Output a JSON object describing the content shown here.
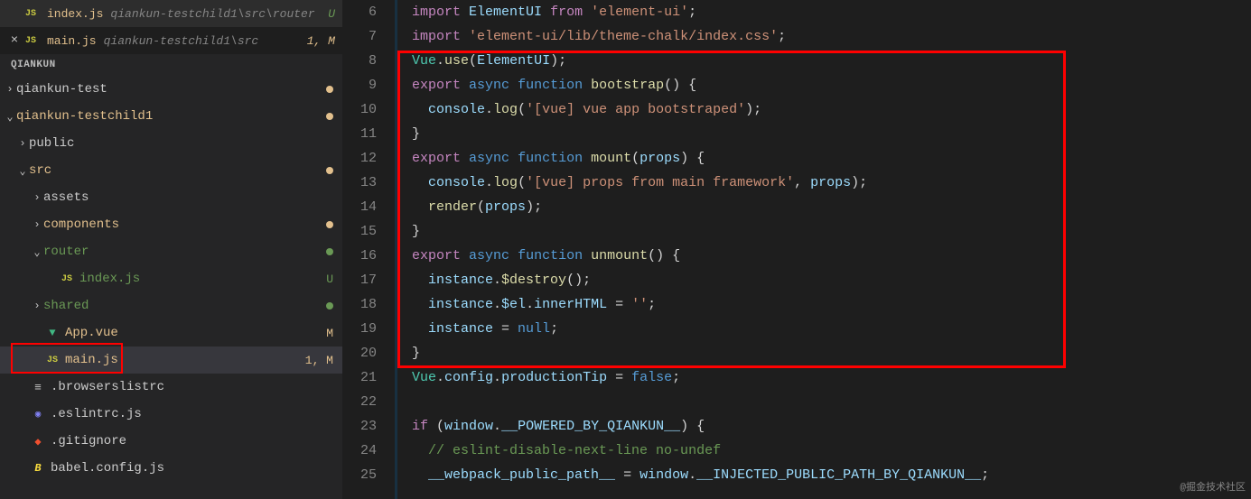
{
  "tabs": [
    {
      "icon": "JS",
      "name": "index.js",
      "path": "qiankun-testchild1\\src\\router",
      "status": "U",
      "statusClass": "status-u",
      "showClose": false,
      "active": false
    },
    {
      "icon": "JS",
      "name": "main.js",
      "path": "qiankun-testchild1\\src",
      "status": "1, M",
      "statusClass": "",
      "showClose": true,
      "active": true
    }
  ],
  "explorer": {
    "title": "QIANKUN",
    "items": [
      {
        "indent": 0,
        "chevron": "›",
        "icon": "",
        "label": "qiankun-test",
        "git": "",
        "dot": "modified"
      },
      {
        "indent": 0,
        "chevron": "⌄",
        "icon": "",
        "label": "qiankun-testchild1",
        "git": "git-modified",
        "dot": "modified"
      },
      {
        "indent": 1,
        "chevron": "›",
        "icon": "",
        "label": "public",
        "git": "",
        "dot": ""
      },
      {
        "indent": 1,
        "chevron": "⌄",
        "icon": "",
        "label": "src",
        "git": "git-modified",
        "dot": "modified"
      },
      {
        "indent": 2,
        "chevron": "›",
        "icon": "",
        "label": "assets",
        "git": "",
        "dot": ""
      },
      {
        "indent": 2,
        "chevron": "›",
        "icon": "",
        "label": "components",
        "git": "git-modified",
        "dot": "modified"
      },
      {
        "indent": 2,
        "chevron": "⌄",
        "icon": "",
        "label": "router",
        "git": "git-untracked",
        "dot": "untracked"
      },
      {
        "indent": 3,
        "chevron": "",
        "icon": "js",
        "label": "index.js",
        "git": "git-untracked",
        "letter": "U",
        "letterClass": "u"
      },
      {
        "indent": 2,
        "chevron": "›",
        "icon": "",
        "label": "shared",
        "git": "git-untracked",
        "dot": "untracked"
      },
      {
        "indent": 2,
        "chevron": "",
        "icon": "vue",
        "label": "App.vue",
        "git": "git-modified",
        "letter": "M",
        "letterClass": "m"
      },
      {
        "indent": 2,
        "chevron": "",
        "icon": "js",
        "label": "main.js",
        "git": "git-modified",
        "letter": "1, M",
        "letterClass": "m",
        "selected": true,
        "annoBox": true
      },
      {
        "indent": 1,
        "chevron": "",
        "icon": "lines",
        "label": ".browserslistrc",
        "git": ""
      },
      {
        "indent": 1,
        "chevron": "",
        "icon": "eslint",
        "label": ".eslintrc.js",
        "git": ""
      },
      {
        "indent": 1,
        "chevron": "",
        "icon": "git",
        "label": ".gitignore",
        "git": ""
      },
      {
        "indent": 1,
        "chevron": "",
        "icon": "babel",
        "label": "babel.config.js",
        "git": ""
      }
    ]
  },
  "lineStart": 6,
  "lineEnd": 25,
  "code": [
    [
      {
        "c": "tk-keyword",
        "t": "import"
      },
      {
        "c": "",
        "t": " "
      },
      {
        "c": "tk-var",
        "t": "ElementUI"
      },
      {
        "c": "",
        "t": " "
      },
      {
        "c": "tk-keyword",
        "t": "from"
      },
      {
        "c": "",
        "t": " "
      },
      {
        "c": "tk-string",
        "t": "'element-ui'"
      },
      {
        "c": "",
        "t": ";"
      }
    ],
    [
      {
        "c": "tk-keyword",
        "t": "import"
      },
      {
        "c": "",
        "t": " "
      },
      {
        "c": "tk-string",
        "t": "'element-ui/lib/theme-chalk/index.css'"
      },
      {
        "c": "",
        "t": ";"
      }
    ],
    [
      {
        "c": "tk-type",
        "t": "Vue"
      },
      {
        "c": "",
        "t": "."
      },
      {
        "c": "tk-func",
        "t": "use"
      },
      {
        "c": "",
        "t": "("
      },
      {
        "c": "tk-var",
        "t": "ElementUI"
      },
      {
        "c": "",
        "t": ");"
      }
    ],
    [
      {
        "c": "tk-keyword",
        "t": "export"
      },
      {
        "c": "",
        "t": " "
      },
      {
        "c": "tk-storage",
        "t": "async"
      },
      {
        "c": "",
        "t": " "
      },
      {
        "c": "tk-storage",
        "t": "function"
      },
      {
        "c": "",
        "t": " "
      },
      {
        "c": "tk-func",
        "t": "bootstrap"
      },
      {
        "c": "",
        "t": "() {"
      }
    ],
    [
      {
        "c": "",
        "t": "  "
      },
      {
        "c": "tk-var",
        "t": "console"
      },
      {
        "c": "",
        "t": "."
      },
      {
        "c": "tk-func",
        "t": "log"
      },
      {
        "c": "",
        "t": "("
      },
      {
        "c": "tk-string",
        "t": "'[vue] vue app bootstraped'"
      },
      {
        "c": "",
        "t": ");"
      }
    ],
    [
      {
        "c": "",
        "t": "}"
      }
    ],
    [
      {
        "c": "tk-keyword",
        "t": "export"
      },
      {
        "c": "",
        "t": " "
      },
      {
        "c": "tk-storage",
        "t": "async"
      },
      {
        "c": "",
        "t": " "
      },
      {
        "c": "tk-storage",
        "t": "function"
      },
      {
        "c": "",
        "t": " "
      },
      {
        "c": "tk-func",
        "t": "mount"
      },
      {
        "c": "",
        "t": "("
      },
      {
        "c": "tk-var",
        "t": "props"
      },
      {
        "c": "",
        "t": ") {"
      }
    ],
    [
      {
        "c": "",
        "t": "  "
      },
      {
        "c": "tk-var",
        "t": "console"
      },
      {
        "c": "",
        "t": "."
      },
      {
        "c": "tk-func",
        "t": "log"
      },
      {
        "c": "",
        "t": "("
      },
      {
        "c": "tk-string",
        "t": "'[vue] props from main framework'"
      },
      {
        "c": "",
        "t": ", "
      },
      {
        "c": "tk-var",
        "t": "props"
      },
      {
        "c": "",
        "t": ");"
      }
    ],
    [
      {
        "c": "",
        "t": "  "
      },
      {
        "c": "tk-func",
        "t": "render"
      },
      {
        "c": "",
        "t": "("
      },
      {
        "c": "tk-var",
        "t": "props"
      },
      {
        "c": "",
        "t": ");"
      }
    ],
    [
      {
        "c": "",
        "t": "}"
      }
    ],
    [
      {
        "c": "tk-keyword",
        "t": "export"
      },
      {
        "c": "",
        "t": " "
      },
      {
        "c": "tk-storage",
        "t": "async"
      },
      {
        "c": "",
        "t": " "
      },
      {
        "c": "tk-storage",
        "t": "function"
      },
      {
        "c": "",
        "t": " "
      },
      {
        "c": "tk-func",
        "t": "unmount"
      },
      {
        "c": "",
        "t": "() {"
      }
    ],
    [
      {
        "c": "",
        "t": "  "
      },
      {
        "c": "tk-var",
        "t": "instance"
      },
      {
        "c": "",
        "t": "."
      },
      {
        "c": "tk-func",
        "t": "$destroy"
      },
      {
        "c": "",
        "t": "();"
      }
    ],
    [
      {
        "c": "",
        "t": "  "
      },
      {
        "c": "tk-var",
        "t": "instance"
      },
      {
        "c": "",
        "t": "."
      },
      {
        "c": "tk-var",
        "t": "$el"
      },
      {
        "c": "",
        "t": "."
      },
      {
        "c": "tk-var",
        "t": "innerHTML"
      },
      {
        "c": "",
        "t": " = "
      },
      {
        "c": "tk-string",
        "t": "''"
      },
      {
        "c": "",
        "t": ";"
      }
    ],
    [
      {
        "c": "",
        "t": "  "
      },
      {
        "c": "tk-var",
        "t": "instance"
      },
      {
        "c": "",
        "t": " = "
      },
      {
        "c": "tk-const",
        "t": "null"
      },
      {
        "c": "",
        "t": ";"
      }
    ],
    [
      {
        "c": "",
        "t": "}"
      }
    ],
    [
      {
        "c": "tk-type",
        "t": "Vue"
      },
      {
        "c": "",
        "t": "."
      },
      {
        "c": "tk-var",
        "t": "config"
      },
      {
        "c": "",
        "t": "."
      },
      {
        "c": "tk-var",
        "t": "productionTip"
      },
      {
        "c": "",
        "t": " = "
      },
      {
        "c": "tk-const",
        "t": "false"
      },
      {
        "c": "",
        "t": ";"
      }
    ],
    [],
    [
      {
        "c": "tk-keyword",
        "t": "if"
      },
      {
        "c": "",
        "t": " ("
      },
      {
        "c": "tk-var",
        "t": "window"
      },
      {
        "c": "",
        "t": "."
      },
      {
        "c": "tk-var",
        "t": "__POWERED_BY_QIANKUN__"
      },
      {
        "c": "",
        "t": ") {"
      }
    ],
    [
      {
        "c": "",
        "t": "  "
      },
      {
        "c": "tk-comment",
        "t": "// eslint-disable-next-line no-undef"
      }
    ],
    [
      {
        "c": "",
        "t": "  "
      },
      {
        "c": "tk-var",
        "t": "__webpack_public_path__"
      },
      {
        "c": "",
        "t": " = "
      },
      {
        "c": "tk-var",
        "t": "window"
      },
      {
        "c": "",
        "t": "."
      },
      {
        "c": "tk-var",
        "t": "__INJECTED_PUBLIC_PATH_BY_QIANKUN__"
      },
      {
        "c": "",
        "t": ";"
      }
    ]
  ],
  "watermark": "@掘金技术社区"
}
